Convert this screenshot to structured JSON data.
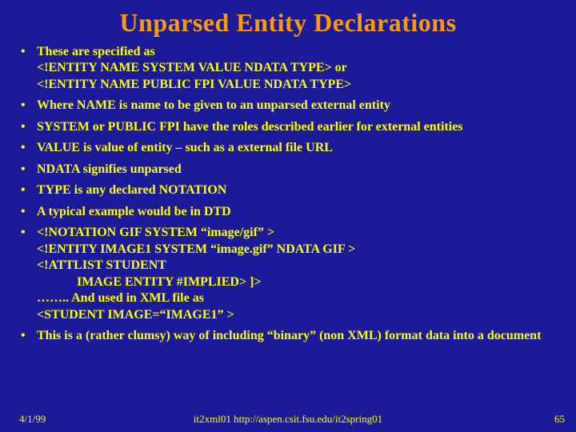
{
  "title": "Unparsed Entity Declarations",
  "bullets": {
    "b0_l1": "These are specified as",
    "b0_l2": "<!ENTITY NAME SYSTEM VALUE NDATA TYPE> or",
    "b0_l3": " <!ENTITY NAME PUBLIC FPI VALUE NDATA TYPE>",
    "b1": "Where NAME is name to be given to an unparsed external entity",
    "b2": "SYSTEM or PUBLIC FPI have the roles described earlier for external entities",
    "b3": "VALUE is value of entity – such as a external file URL",
    "b4": "NDATA signifies unparsed",
    "b5": "TYPE is any declared NOTATION",
    "b6": "A typical example would be in DTD",
    "b7_l1": "<!NOTATION GIF SYSTEM “image/gif” >",
    "b7_l2": "<!ENTITY IMAGE1 SYSTEM “image.gif” NDATA GIF >",
    "b7_l3": "<!ATTLIST STUDENT",
    "b7_l4": "IMAGE ENTITY #IMPLIED> ]>",
    "b7_l5": "……..                      And used in XML file as",
    "b7_l6": "<STUDENT IMAGE=“IMAGE1” >",
    "b8": "This is a (rather clumsy) way of including “binary” (non XML) format data into a document"
  },
  "footer": {
    "date": "4/1/99",
    "center": "it2xml01  http://aspen.csit.fsu.edu/it2spring01",
    "page": "65"
  }
}
